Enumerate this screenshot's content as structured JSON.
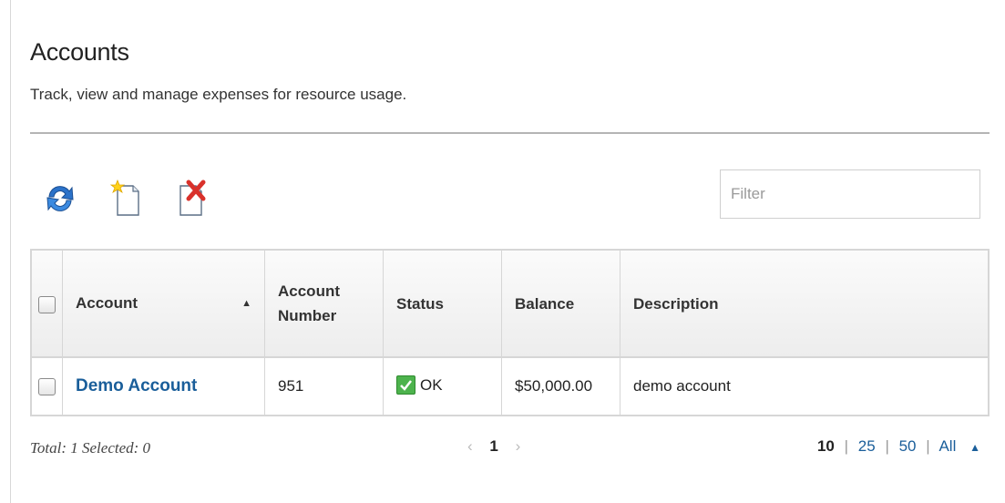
{
  "header": {
    "title": "Accounts",
    "subtitle": "Track, view and manage expenses for resource usage."
  },
  "toolbar": {
    "icons": [
      "refresh-icon",
      "new-account-icon",
      "delete-icon"
    ],
    "filter_placeholder": "Filter"
  },
  "table": {
    "columns": [
      "Account",
      "Account Number",
      "Status",
      "Balance",
      "Description"
    ],
    "sort_column": "Account",
    "sort_direction": "ascending",
    "rows": [
      {
        "account": "Demo Account",
        "account_number": "951",
        "status": "OK",
        "balance": "$50,000.00",
        "description": "demo account"
      }
    ]
  },
  "footer": {
    "total_text": "Total: 1 Selected: 0",
    "current_page": "1",
    "prev_symbol": "‹",
    "next_symbol": "›",
    "page_sizes": [
      "10",
      "25",
      "50",
      "All"
    ],
    "active_page_size": "10",
    "separator": "|"
  },
  "colors": {
    "link": "#1a5e9a",
    "status_ok": "#4db34d",
    "rule": "#b5b5b5",
    "delete_red": "#d9312b",
    "refresh_blue": "#2b72c9"
  }
}
